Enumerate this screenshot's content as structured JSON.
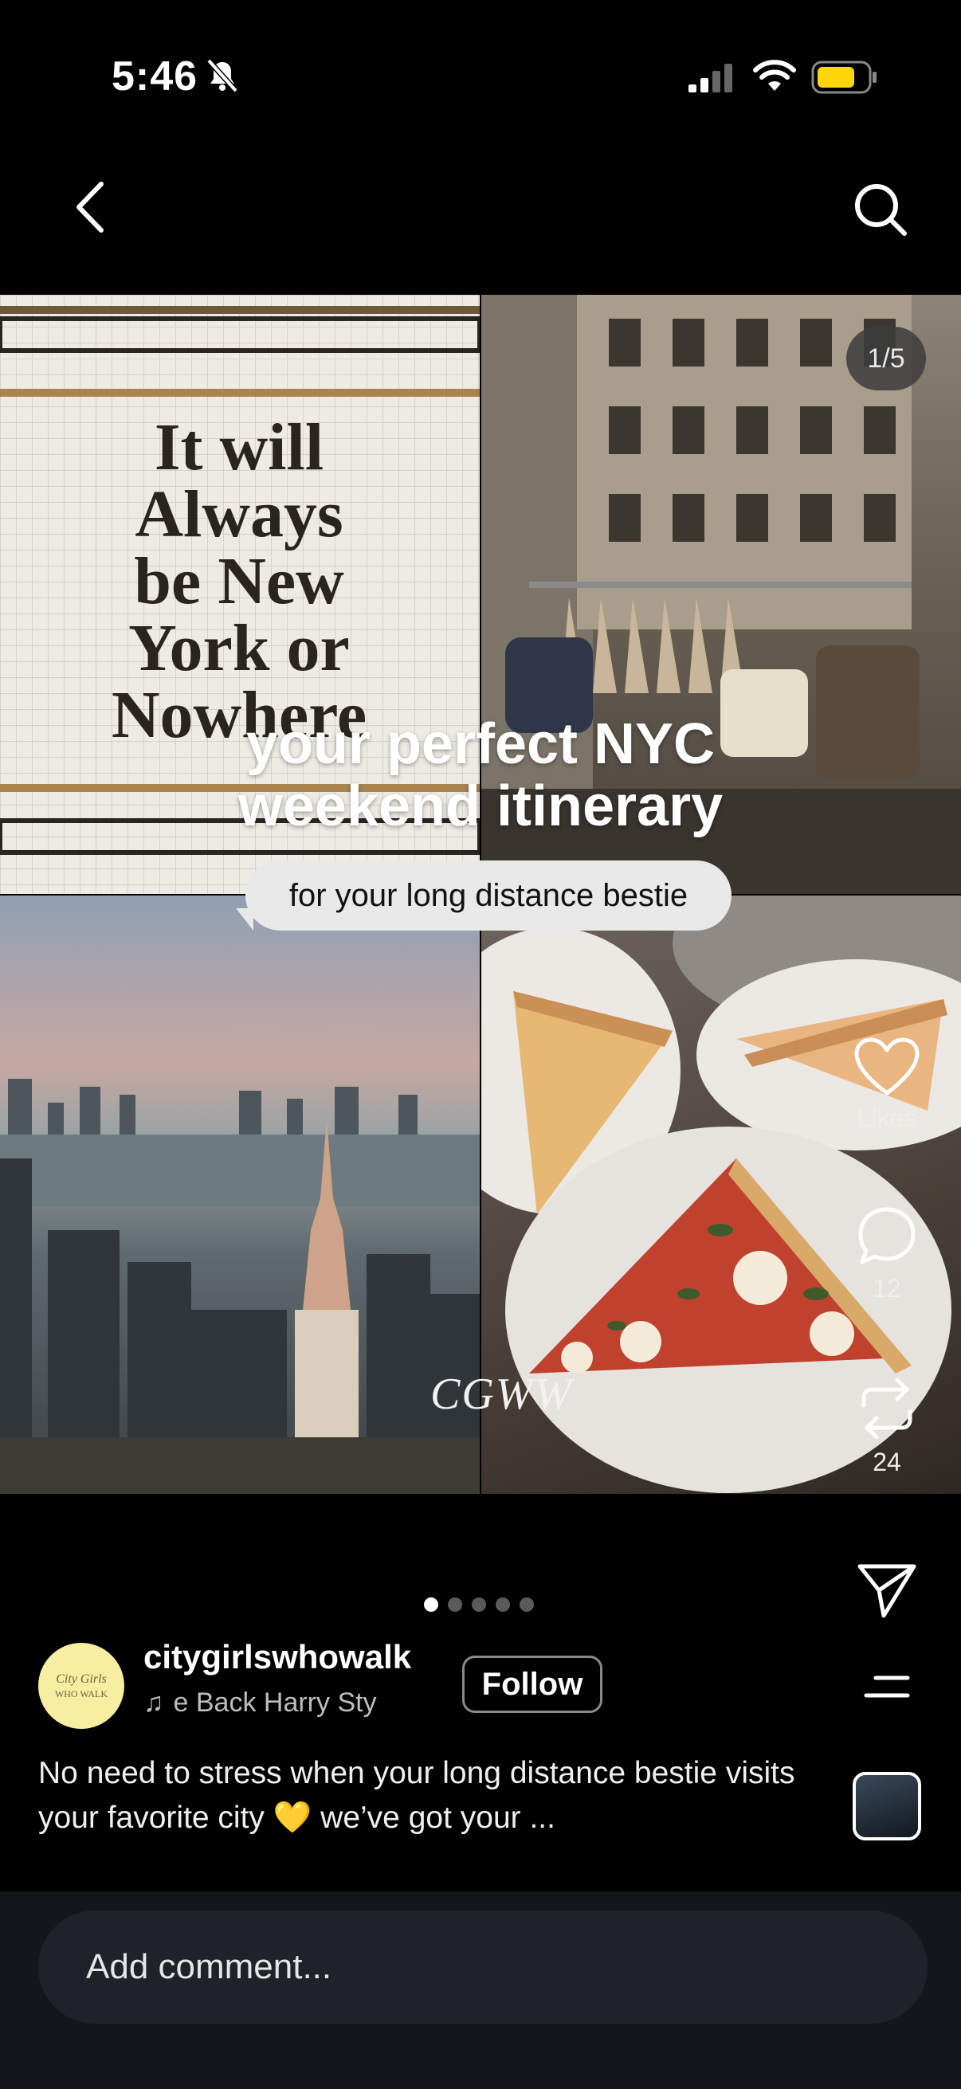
{
  "status_bar": {
    "time": "5:46"
  },
  "media": {
    "counter": "1/5",
    "sign_text": [
      "It will",
      "Always",
      "be New",
      "York or",
      "Nowhere"
    ],
    "headline_line1": "your perfect NYC",
    "headline_line2": "weekend itinerary",
    "subtitle": "for your long distance bestie",
    "watermark": "CGWW"
  },
  "actions": {
    "like_label": "Likes",
    "comment_count": "12",
    "repost_count": "24"
  },
  "carousel": {
    "total": 5,
    "active": 0
  },
  "post": {
    "username": "citygirlswhowalk",
    "music": "e Back    Harry Sty",
    "follow_label": "Follow",
    "caption": "No need to stress when your long distance bestie visits your favorite city 💛 we’ve got your ..."
  },
  "comment": {
    "placeholder": "Add comment..."
  }
}
